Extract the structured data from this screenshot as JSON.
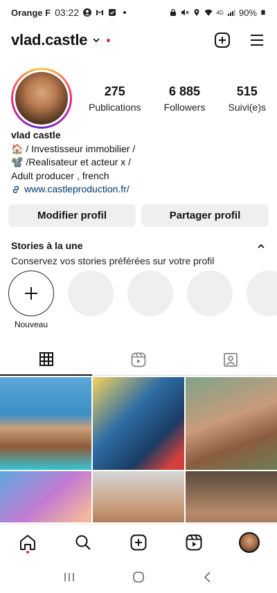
{
  "status_bar": {
    "carrier": "Orange F",
    "time": "03:22",
    "network": "4G",
    "battery": "90%"
  },
  "header": {
    "username": "vlad.castle"
  },
  "profile": {
    "stats": [
      {
        "value": "275",
        "label": "Publications"
      },
      {
        "value": "6 885",
        "label": "Followers"
      },
      {
        "value": "515",
        "label": "Suivi(e)s"
      }
    ]
  },
  "bio": {
    "name": "vlad castle",
    "line1": "🏠 / Investisseur immobilier /",
    "line2": "📽️ /Realisateur et acteur x /",
    "line3": "Adult producer , french",
    "link": "www.castleproduction.fr/"
  },
  "actions": {
    "edit": "Modifier profil",
    "share": "Partager profil"
  },
  "stories": {
    "title": "Stories à la une",
    "description": "Conservez vos stories préférées sur votre profil",
    "new_label": "Nouveau"
  },
  "colors": {
    "accent_red": "#e0245e",
    "link_blue": "#00376b",
    "button_bg": "#efefef"
  }
}
